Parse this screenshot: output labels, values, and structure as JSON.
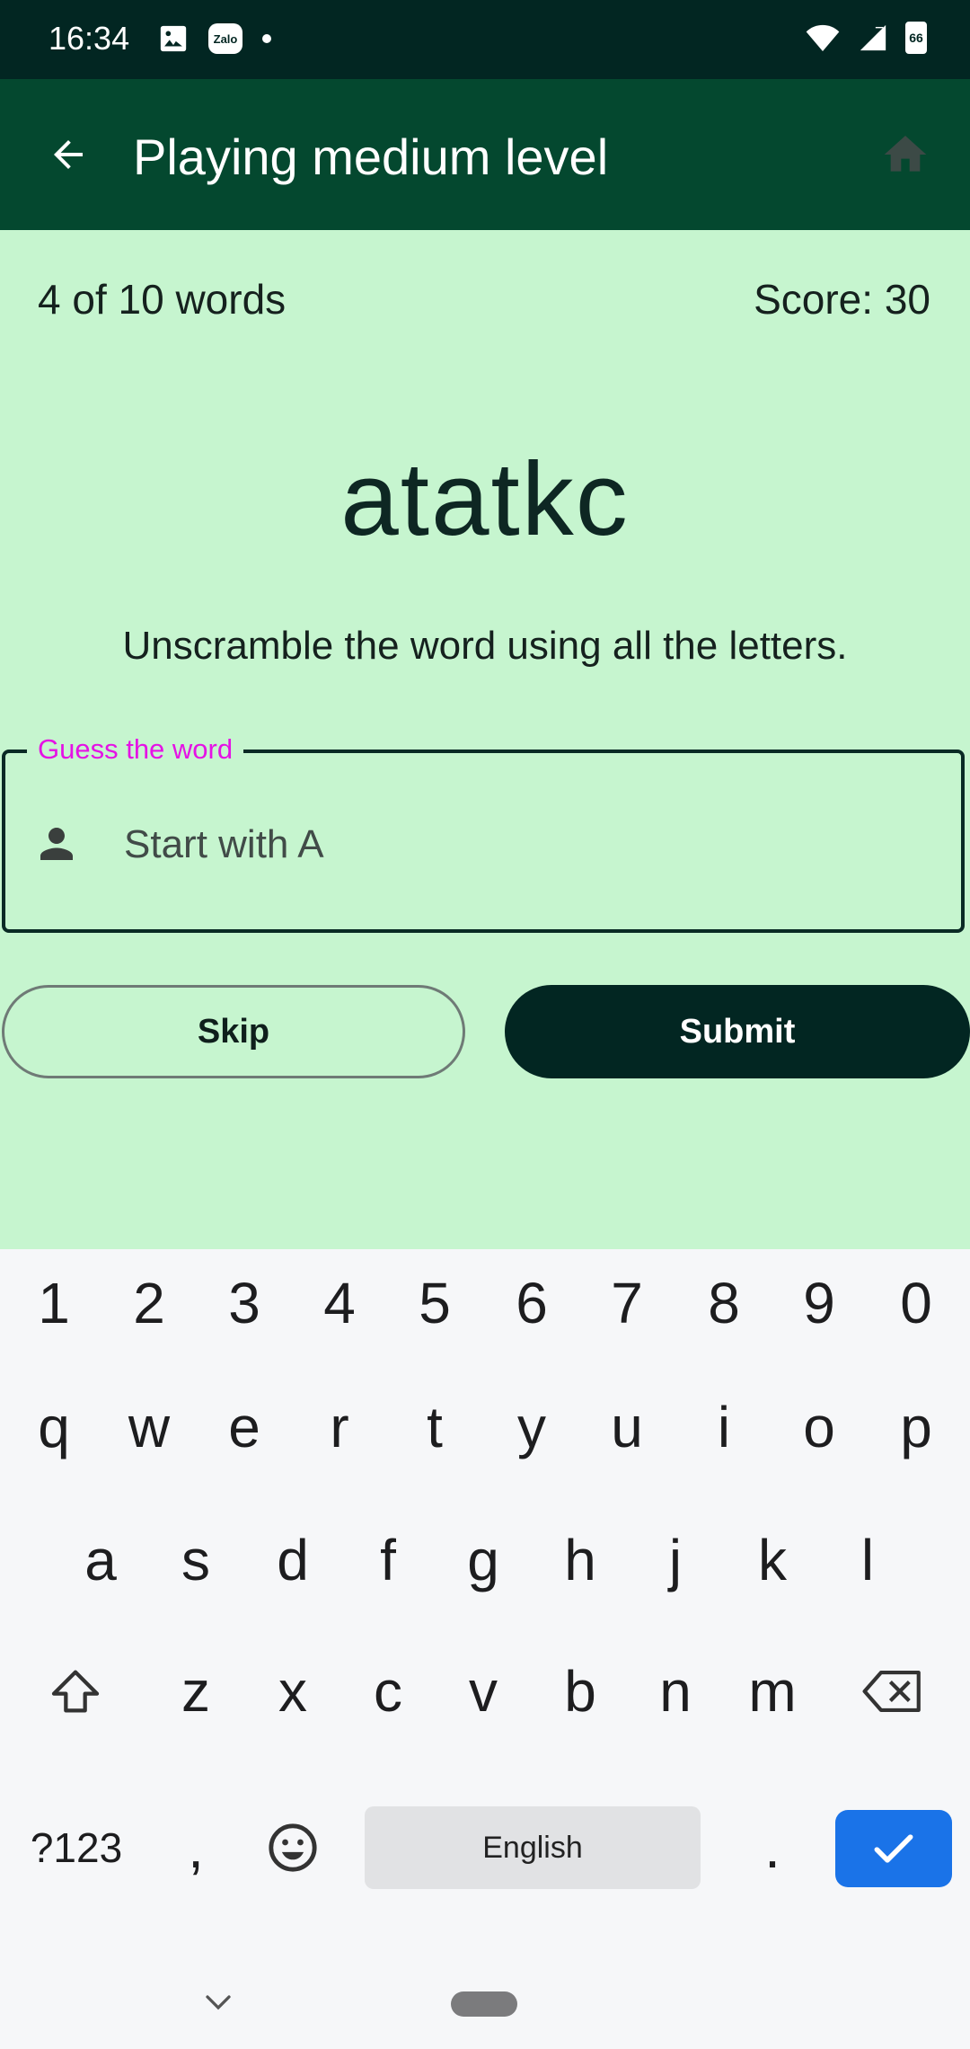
{
  "status_bar": {
    "time": "16:34",
    "left_icons": [
      "image-icon",
      "zalo-icon",
      "dot-icon"
    ],
    "right_icons": [
      "wifi-icon",
      "signal-icon",
      "battery-icon"
    ],
    "zalo_text": "Zalo",
    "battery_level": "66"
  },
  "app_bar": {
    "title": "Playing medium level",
    "back_icon": "arrow-back-icon",
    "home_icon": "home-icon",
    "color": "#04482f"
  },
  "game": {
    "progress": "4 of 10 words",
    "score": "Score: 30",
    "scrambled_word": "atatkc",
    "instructions": "Unscramble the word using all the letters."
  },
  "guess_field": {
    "label": "Guess the word",
    "placeholder": "Start with A",
    "value": "",
    "icon": "person-icon",
    "label_color": "#e512e5"
  },
  "buttons": {
    "skip": "Skip",
    "submit": "Submit"
  },
  "keyboard": {
    "row_numbers": [
      "1",
      "2",
      "3",
      "4",
      "5",
      "6",
      "7",
      "8",
      "9",
      "0"
    ],
    "row_q": [
      "q",
      "w",
      "e",
      "r",
      "t",
      "y",
      "u",
      "i",
      "o",
      "p"
    ],
    "row_a": [
      "a",
      "s",
      "d",
      "f",
      "g",
      "h",
      "j",
      "k",
      "l"
    ],
    "row_z": [
      "z",
      "x",
      "c",
      "v",
      "b",
      "n",
      "m"
    ],
    "symbols": "?123",
    "comma": ",",
    "space": "English",
    "period": ".",
    "icons": [
      "shift-icon",
      "backspace-icon",
      "emoji-icon",
      "check-icon",
      "chevron-down-icon"
    ],
    "enter_color": "#1a73e8"
  }
}
